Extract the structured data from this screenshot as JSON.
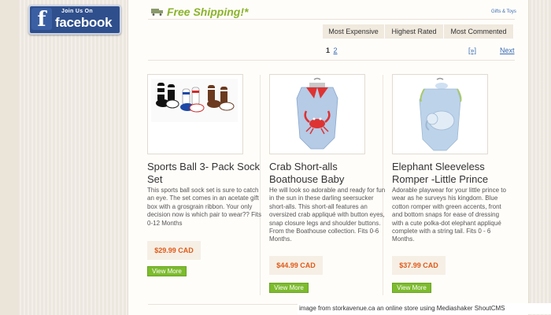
{
  "facebook": {
    "join_text": "Join Us On",
    "brand_text": "facebook",
    "f_letter": "f"
  },
  "header": {
    "shipping_text": "Free Shipping!*",
    "category_link": "Gifts & Toys"
  },
  "sort": {
    "options": [
      "Most Expensive",
      "Highest Rated",
      "Most Commented"
    ]
  },
  "pagination": {
    "current": "1",
    "pages": [
      "2"
    ],
    "all_label": "[»]",
    "next_label": "Next"
  },
  "products": [
    {
      "title": "Sports Ball 3- Pack Sock Set",
      "description": "This sports ball sock set is sure to catch an eye. The set comes in an acetate gift box with a grosgrain ribbon. Your only decision now is which pair to wear?? Fits 0-12 Months",
      "price": "$29.99 CAD",
      "more_label": "View More",
      "image_icon": "sock-set-image"
    },
    {
      "title": "Crab Short-alls Boathouse Baby",
      "description": "He will look so adorable and ready for fun in the sun in these darling seersucker short-alls. This short-all features an oversized crab appliqué with button eyes, snap closure legs and shoulder buttons. From the Boathouse collection. Fits 0-6 Months.",
      "price": "$44.99 CAD",
      "more_label": "View More",
      "image_icon": "crab-shortall-image"
    },
    {
      "title": "Elephant Sleeveless Romper -Little Prince",
      "description": "Adorable playwear for your little prince to wear as he surveys his kingdom. Blue cotton romper with green accents, front and bottom snaps for ease of dressing with a cute polka-dot elephant appliqué complete with a string tail. Fits 0 - 6 Months.",
      "price": "$37.99 CAD",
      "more_label": "View More",
      "image_icon": "elephant-romper-image"
    }
  ],
  "footer": {
    "credit": "image from storkavenue.ca an online store using Mediashaker ShoutCMS"
  },
  "colors": {
    "accent_green": "#8ab32b",
    "price_orange": "#e05a18",
    "link_blue": "#3a6cb0",
    "button_green": "#7dbb2e"
  }
}
